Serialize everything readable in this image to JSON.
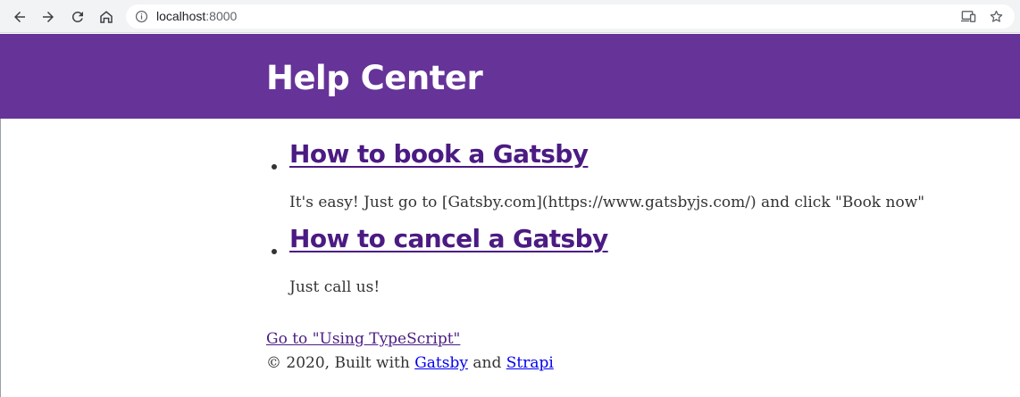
{
  "browser": {
    "url_host": "localhost",
    "url_port": ":8000"
  },
  "header": {
    "title": "Help Center",
    "background": "#663399"
  },
  "faq": [
    {
      "question": "How to book a Gatsby",
      "answer": "It's easy! Just go to [Gatsby.com](https://www.gatsbyjs.com/) and click \"Book now\""
    },
    {
      "question": "How to cancel a Gatsby",
      "answer": "Just call us!"
    }
  ],
  "footer": {
    "link_label": "Go to \"Using TypeScript\"",
    "copyright_prefix": "© 2020, Built with ",
    "gatsby_label": "Gatsby",
    "and_label": " and ",
    "strapi_label": "Strapi"
  }
}
